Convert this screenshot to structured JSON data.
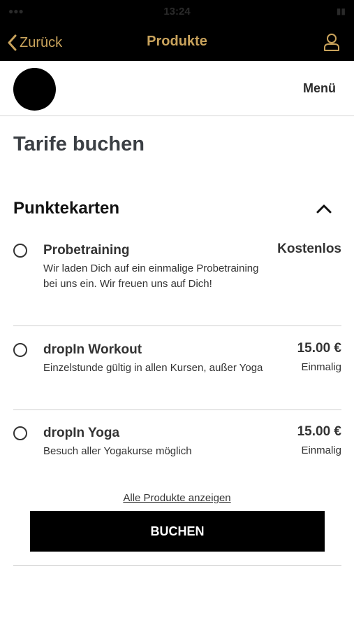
{
  "status_bar": {
    "time": "13:24"
  },
  "nav": {
    "back_label": "Zurück",
    "title": "Produkte"
  },
  "header": {
    "menu_label": "Menü"
  },
  "page": {
    "title": "Tarife buchen"
  },
  "section": {
    "title": "Punktekarten"
  },
  "products": [
    {
      "name": "Probetraining",
      "description": "Wir laden Dich auf ein einmalige Probetraining bei uns ein. Wir freuen uns auf Dich!",
      "price": "Kostenlos",
      "frequency": ""
    },
    {
      "name": "dropIn Workout",
      "description": "Einzelstunde gültig in allen Kursen, außer Yoga",
      "price": "15.00 €",
      "frequency": "Einmalig"
    },
    {
      "name": "dropIn Yoga",
      "description": "Besuch aller Yogakurse möglich",
      "price": "15.00 €",
      "frequency": "Einmalig"
    }
  ],
  "actions": {
    "all_products_label": "Alle Produkte anzeigen",
    "book_label": "BUCHEN"
  },
  "colors": {
    "accent": "#c9a35c",
    "nav_bg": "#000000"
  }
}
